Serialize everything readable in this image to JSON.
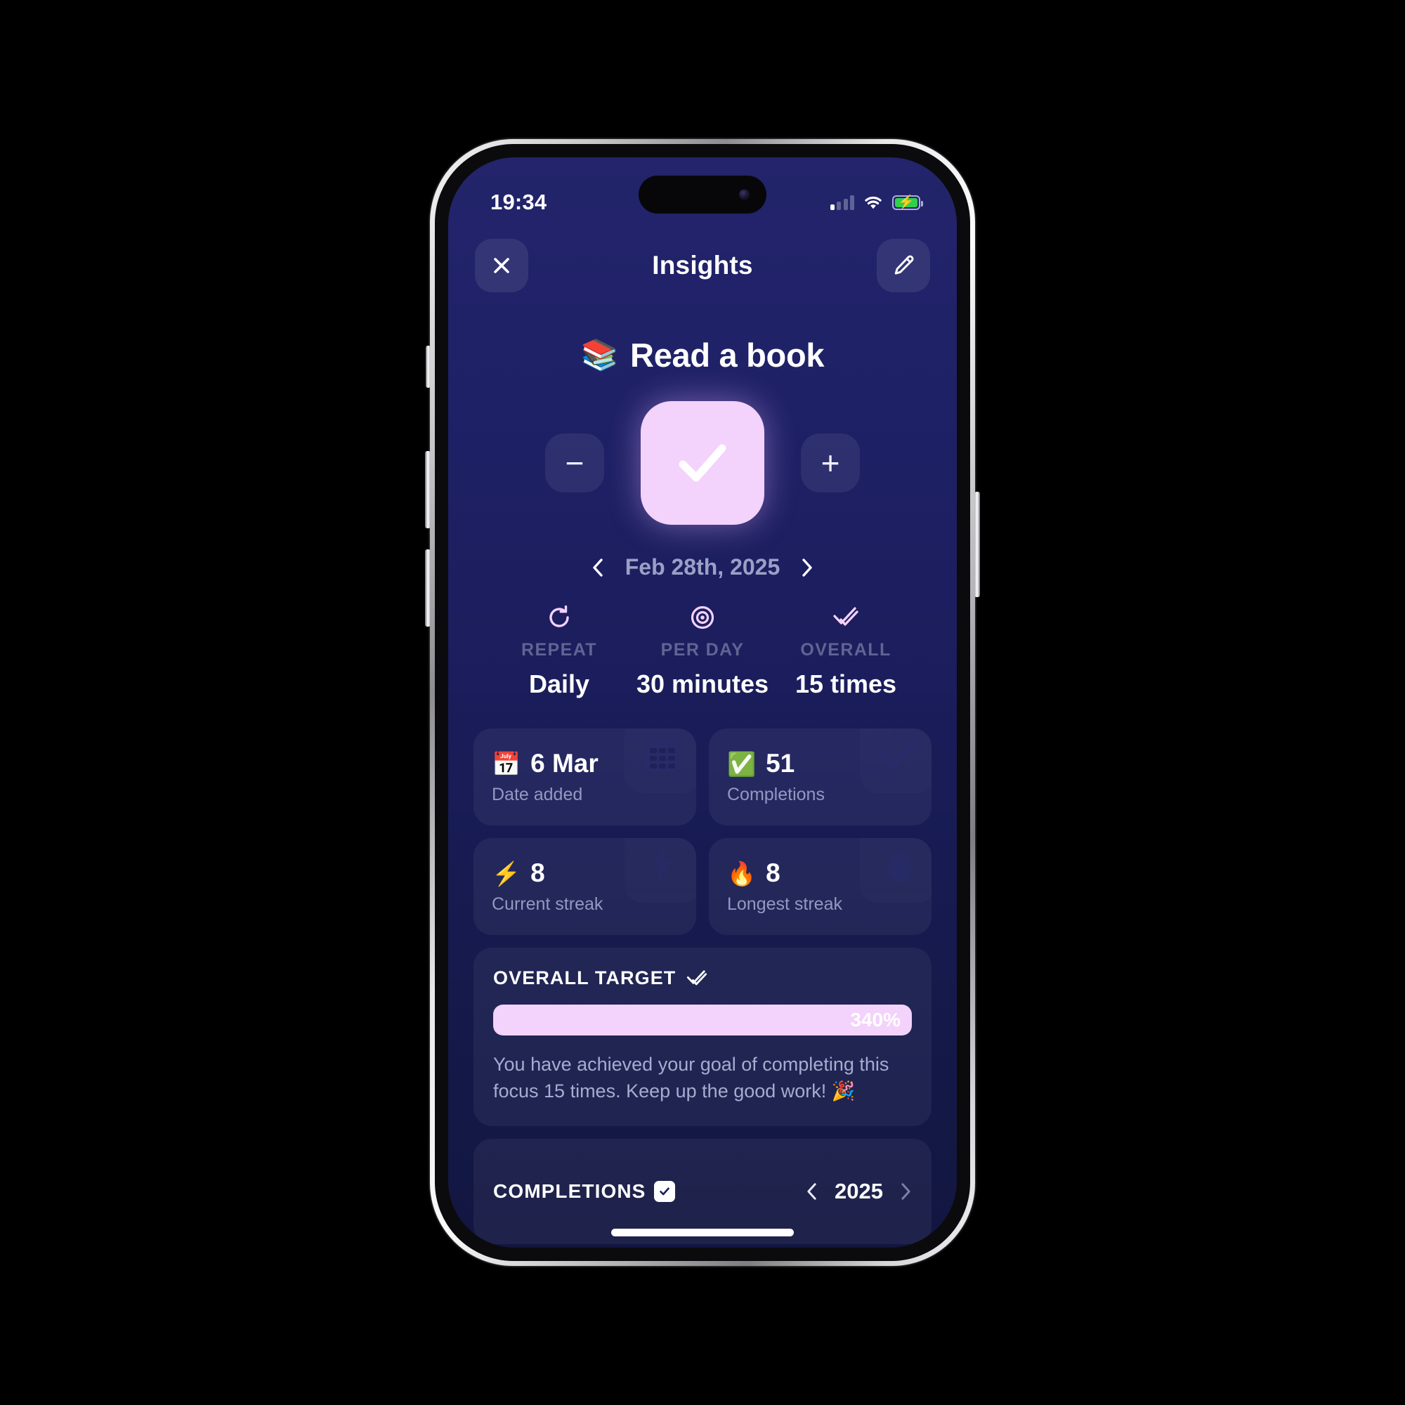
{
  "status_bar": {
    "time": "19:34",
    "signal_icon": "cellular-signal-icon",
    "wifi_icon": "wifi-icon",
    "battery_icon": "battery-charging-icon",
    "battery_color": "#2fd14a"
  },
  "header": {
    "title": "Insights",
    "close_icon": "close-icon",
    "edit_icon": "pencil-icon"
  },
  "habit": {
    "emoji": "📚",
    "name": "Read a book",
    "decrement_label": "−",
    "increment_label": "+",
    "check_icon": "checkmark-icon",
    "check_card_color": "#f3d2fb"
  },
  "date_nav": {
    "prev_icon": "chevron-left-icon",
    "label": "Feb 28th, 2025",
    "next_icon": "chevron-right-icon"
  },
  "metrics": [
    {
      "icon": "repeat-icon",
      "label": "REPEAT",
      "value": "Daily"
    },
    {
      "icon": "target-icon",
      "label": "PER DAY",
      "value": "30 minutes"
    },
    {
      "icon": "double-check-icon",
      "label": "OVERALL",
      "value": "15 times"
    }
  ],
  "stat_cards": [
    {
      "emoji": "📅",
      "value": "6 Mar",
      "sub": "Date added",
      "watermark": "calendar-icon"
    },
    {
      "emoji": "✅",
      "value": "51",
      "sub": "Completions",
      "watermark": "check-icon"
    },
    {
      "emoji": "⚡",
      "value": "8",
      "sub": "Current streak",
      "watermark": "bolt-icon"
    },
    {
      "emoji": "🔥",
      "value": "8",
      "sub": "Longest streak",
      "watermark": "flame-icon"
    }
  ],
  "overall_target": {
    "title": "OVERALL TARGET",
    "icon": "double-check-icon",
    "percent_label": "340%",
    "progress": 100,
    "bar_color": "#f3d2fb",
    "message": "You have achieved your goal of completing this focus 15 times. Keep up the good work! 🎉"
  },
  "completions_section": {
    "title": "COMPLETIONS",
    "badge_icon": "check-badge-icon",
    "prev_icon": "chevron-left-icon",
    "year": "2025",
    "next_icon": "chevron-right-icon"
  },
  "theme": {
    "background_top": "#23246b",
    "background_bottom": "#121640",
    "accent": "#f3d2fb",
    "muted_text": "#9299c2"
  }
}
